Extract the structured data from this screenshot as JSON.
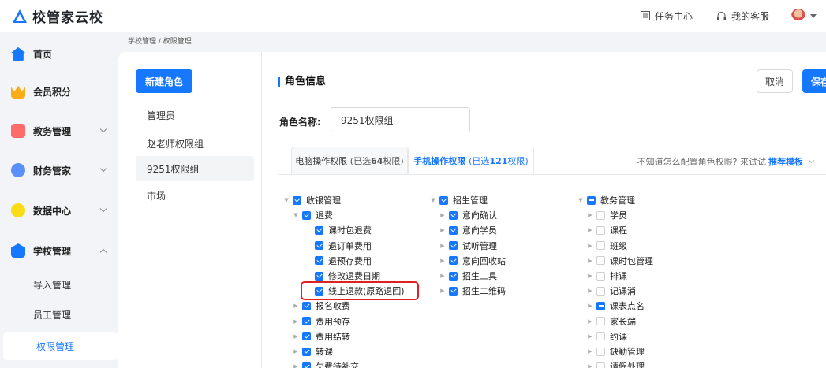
{
  "app": {
    "name": "校管家云校"
  },
  "topbar": {
    "task_center": "任务中心",
    "support": "我的客服"
  },
  "sidebar": {
    "items": [
      {
        "label": "首页",
        "color": "#1677ff"
      },
      {
        "label": "会员积分",
        "color": "#faad14"
      },
      {
        "label": "教务管理",
        "color": "#ff6b6b"
      },
      {
        "label": "财务管家",
        "color": "#5b8ff9"
      },
      {
        "label": "数据中心",
        "color": "#fadb14"
      },
      {
        "label": "学校管理",
        "color": "#1677ff"
      }
    ],
    "sub_items": [
      "导入管理",
      "员工管理",
      "权限管理"
    ]
  },
  "breadcrumb": "学校管理 / 权限管理",
  "roles": {
    "new_button": "新建角色",
    "list": [
      "管理员",
      "赵老师权限组",
      "9251权限组",
      "市场"
    ]
  },
  "detail": {
    "title": "角色信息",
    "cancel": "取消",
    "save": "保存",
    "name_label": "角色名称:",
    "name_value": "9251权限组",
    "tabs": [
      {
        "label": "电脑操作权限",
        "count_prefix": "(已选",
        "count": "64",
        "count_suffix": "权限)"
      },
      {
        "label": "手机操作权限",
        "count_prefix": "(已选",
        "count": "121",
        "count_suffix": "权限)"
      }
    ],
    "hint_text": "不知道怎么配置角色权限? 来试试",
    "hint_link": "推荐模板"
  },
  "tree": {
    "col1": [
      {
        "label": "收银管理",
        "state": "checked",
        "tw": "down"
      },
      {
        "label": "退费",
        "state": "checked",
        "tw": "down"
      },
      {
        "label": "课时包退费",
        "state": "checked",
        "tw": ""
      },
      {
        "label": "退订单费用",
        "state": "checked",
        "tw": ""
      },
      {
        "label": "退预存费用",
        "state": "checked",
        "tw": ""
      },
      {
        "label": "修改退费日期",
        "state": "checked",
        "tw": ""
      },
      {
        "label": "线上退款(原路退回)",
        "state": "checked",
        "tw": ""
      },
      {
        "label": "报名收费",
        "state": "checked",
        "tw": "right"
      },
      {
        "label": "费用预存",
        "state": "checked",
        "tw": "right"
      },
      {
        "label": "费用结转",
        "state": "checked",
        "tw": "right"
      },
      {
        "label": "转课",
        "state": "checked",
        "tw": "right"
      },
      {
        "label": "欠费待补交",
        "state": "checked",
        "tw": "right"
      }
    ],
    "col2": [
      {
        "label": "招生管理",
        "state": "checked",
        "tw": "down"
      },
      {
        "label": "意向确认",
        "state": "checked",
        "tw": "right"
      },
      {
        "label": "意向学员",
        "state": "checked",
        "tw": "right"
      },
      {
        "label": "试听管理",
        "state": "checked",
        "tw": "right"
      },
      {
        "label": "意向回收站",
        "state": "checked",
        "tw": "right"
      },
      {
        "label": "招生工具",
        "state": "checked",
        "tw": "right"
      },
      {
        "label": "招生二维码",
        "state": "checked",
        "tw": "right"
      }
    ],
    "col3": [
      {
        "label": "教务管理",
        "state": "partial",
        "tw": "down"
      },
      {
        "label": "学员",
        "state": "empty",
        "tw": "right"
      },
      {
        "label": "课程",
        "state": "empty",
        "tw": "right"
      },
      {
        "label": "班级",
        "state": "empty",
        "tw": "right"
      },
      {
        "label": "课时包管理",
        "state": "empty",
        "tw": "right"
      },
      {
        "label": "排课",
        "state": "empty",
        "tw": "right"
      },
      {
        "label": "记课消",
        "state": "empty",
        "tw": "right"
      },
      {
        "label": "课表点名",
        "state": "partial",
        "tw": "right"
      },
      {
        "label": "家长端",
        "state": "empty",
        "tw": "right"
      },
      {
        "label": "约课",
        "state": "empty",
        "tw": "right"
      },
      {
        "label": "缺勤管理",
        "state": "empty",
        "tw": "right"
      },
      {
        "label": "请假处理",
        "state": "empty",
        "tw": "right"
      }
    ]
  }
}
